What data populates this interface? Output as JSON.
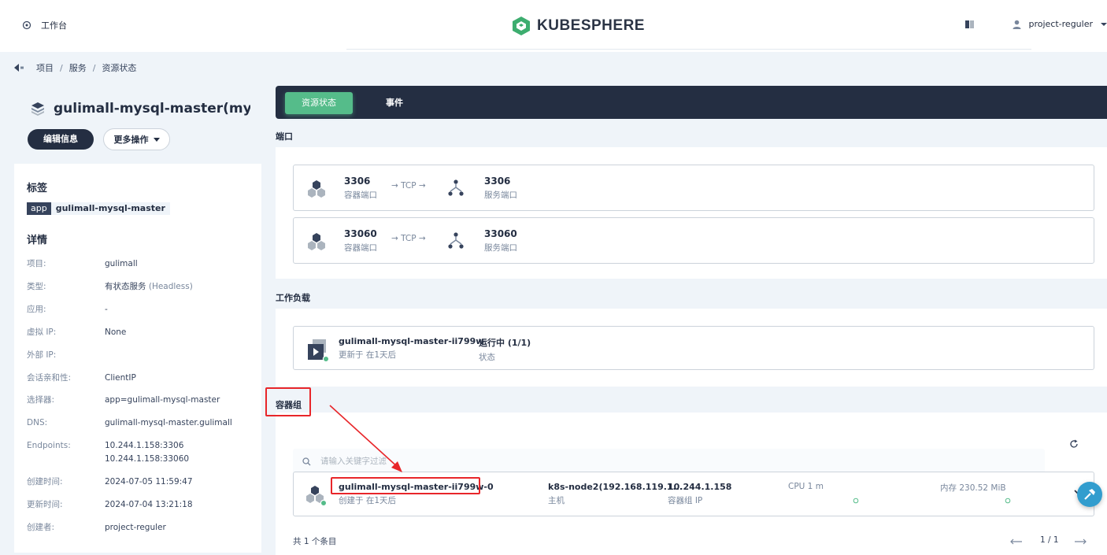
{
  "header": {
    "workbench": "工作台",
    "logo_text": "KUBESPHERE",
    "user": "project-reguler"
  },
  "breadcrumb": [
    "项目",
    "服务",
    "资源状态"
  ],
  "service": {
    "name": "gulimall-mysql-master(mysq...",
    "edit_label": "编辑信息",
    "more_label": "更多操作"
  },
  "labels": {
    "title": "标签",
    "key": "app",
    "value": "gulimall-mysql-master"
  },
  "details": {
    "title": "详情",
    "rows": [
      {
        "k": "项目:",
        "v": "gulimall"
      },
      {
        "k": "类型:",
        "v": "有状态服务",
        "v2": "(Headless)"
      },
      {
        "k": "应用:",
        "v": "-"
      },
      {
        "k": "虚拟 IP:",
        "v": "None"
      },
      {
        "k": "外部 IP:",
        "v": ""
      },
      {
        "k": "会话亲和性:",
        "v": "ClientIP"
      },
      {
        "k": "选择器:",
        "v": "app=gulimall-mysql-master"
      },
      {
        "k": "DNS:",
        "v": "gulimall-mysql-master.gulimall"
      },
      {
        "k": "Endpoints:",
        "v": "10.244.1.158:3306",
        "v3": "10.244.1.158:33060"
      },
      {
        "k": "创建时间:",
        "v": "2024-07-05 11:59:47"
      },
      {
        "k": "更新时间:",
        "v": "2024-07-04 13:21:18"
      },
      {
        "k": "创建者:",
        "v": "project-reguler"
      }
    ]
  },
  "tabs": {
    "active": "资源状态",
    "other": "事件"
  },
  "ports": {
    "title": "端口",
    "items": [
      {
        "container_port": "3306",
        "container_label": "容器端口",
        "protocol": "→ TCP →",
        "service_port": "3306",
        "service_label": "服务端口"
      },
      {
        "container_port": "33060",
        "container_label": "容器端口",
        "protocol": "→ TCP →",
        "service_port": "33060",
        "service_label": "服务端口"
      }
    ]
  },
  "workload": {
    "title": "工作负载",
    "name": "gulimall-mysql-master-ii799w",
    "updated": "更新于 在1天后",
    "status": "运行中 (1/1)",
    "status_label": "状态"
  },
  "pods": {
    "title": "容器组",
    "search_placeholder": "请输入关键字过滤",
    "item": {
      "name": "gulimall-mysql-master-ii799w-0",
      "created": "创建于 在1天后",
      "node": "k8s-node2(192.168.119.1...",
      "node_label": "主机",
      "ip": "10.244.1.158",
      "ip_label": "容器组 IP",
      "cpu": "CPU 1 m",
      "memory": "内存 230.52 MiB"
    },
    "total": "共 1 个条目",
    "pagination": "1 / 1"
  },
  "colors": {
    "accent": "#55bc8a",
    "dark": "#242e42",
    "annotation": "#e8262a",
    "help": "#329dce"
  }
}
